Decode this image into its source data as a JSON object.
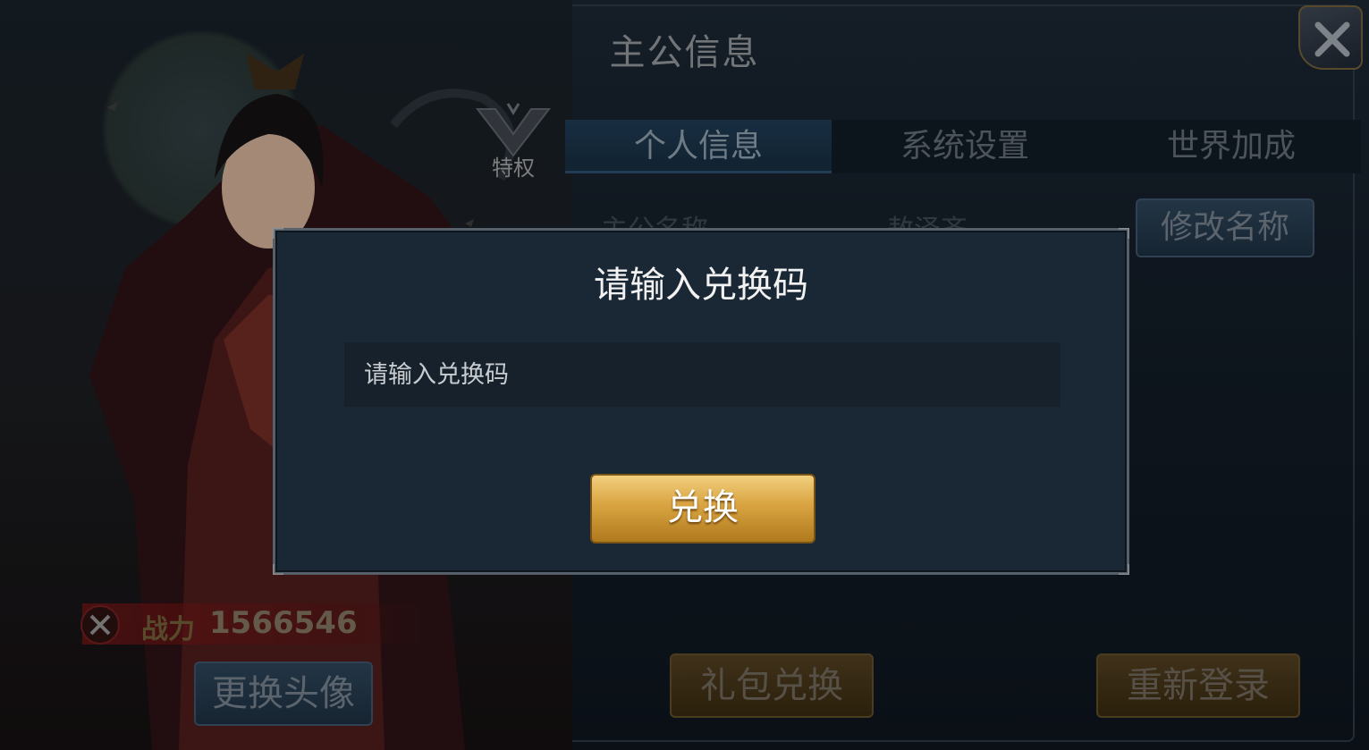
{
  "panel": {
    "title": "主公信息",
    "close_icon": "close-icon",
    "vip_badge_label": "特权",
    "tabs": [
      {
        "label": "个人信息",
        "active": true
      },
      {
        "label": "系统设置",
        "active": false
      },
      {
        "label": "世界加成",
        "active": false
      }
    ],
    "info_row": {
      "label": "主公名称",
      "value": "敖泽齐"
    },
    "rename_button": "修改名称",
    "power": {
      "label": "战力",
      "value": "1566546",
      "icon": "crossed-swords-icon"
    },
    "buttons": {
      "change_avatar": "更换头像",
      "gift_redeem": "礼包兑换",
      "relogin": "重新登录"
    }
  },
  "dialog": {
    "title": "请输入兑换码",
    "input_placeholder": "请输入兑换码",
    "input_value": "",
    "submit_button": "兑换"
  },
  "colors": {
    "dialog_bg": "#1a2836",
    "gold_button": "#d8a340",
    "blue_button": "#2b4155"
  }
}
